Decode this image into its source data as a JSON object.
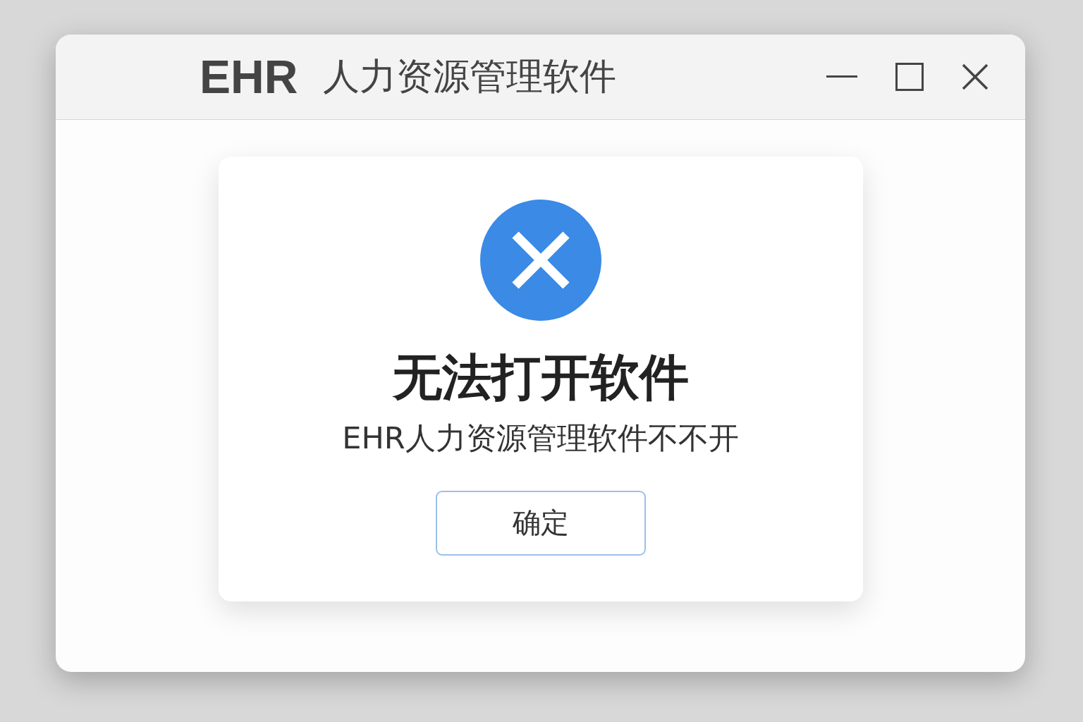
{
  "window": {
    "title_brand": "EHR",
    "title": "人力资源管理软件",
    "controls": [
      {
        "kind": "minimize"
      },
      {
        "kind": "maximize"
      },
      {
        "kind": "close"
      }
    ]
  },
  "dialog": {
    "kind": "error",
    "heading": "无法打开软件",
    "message": "EHR人力资源管理软件不不开",
    "button": "确定"
  }
}
